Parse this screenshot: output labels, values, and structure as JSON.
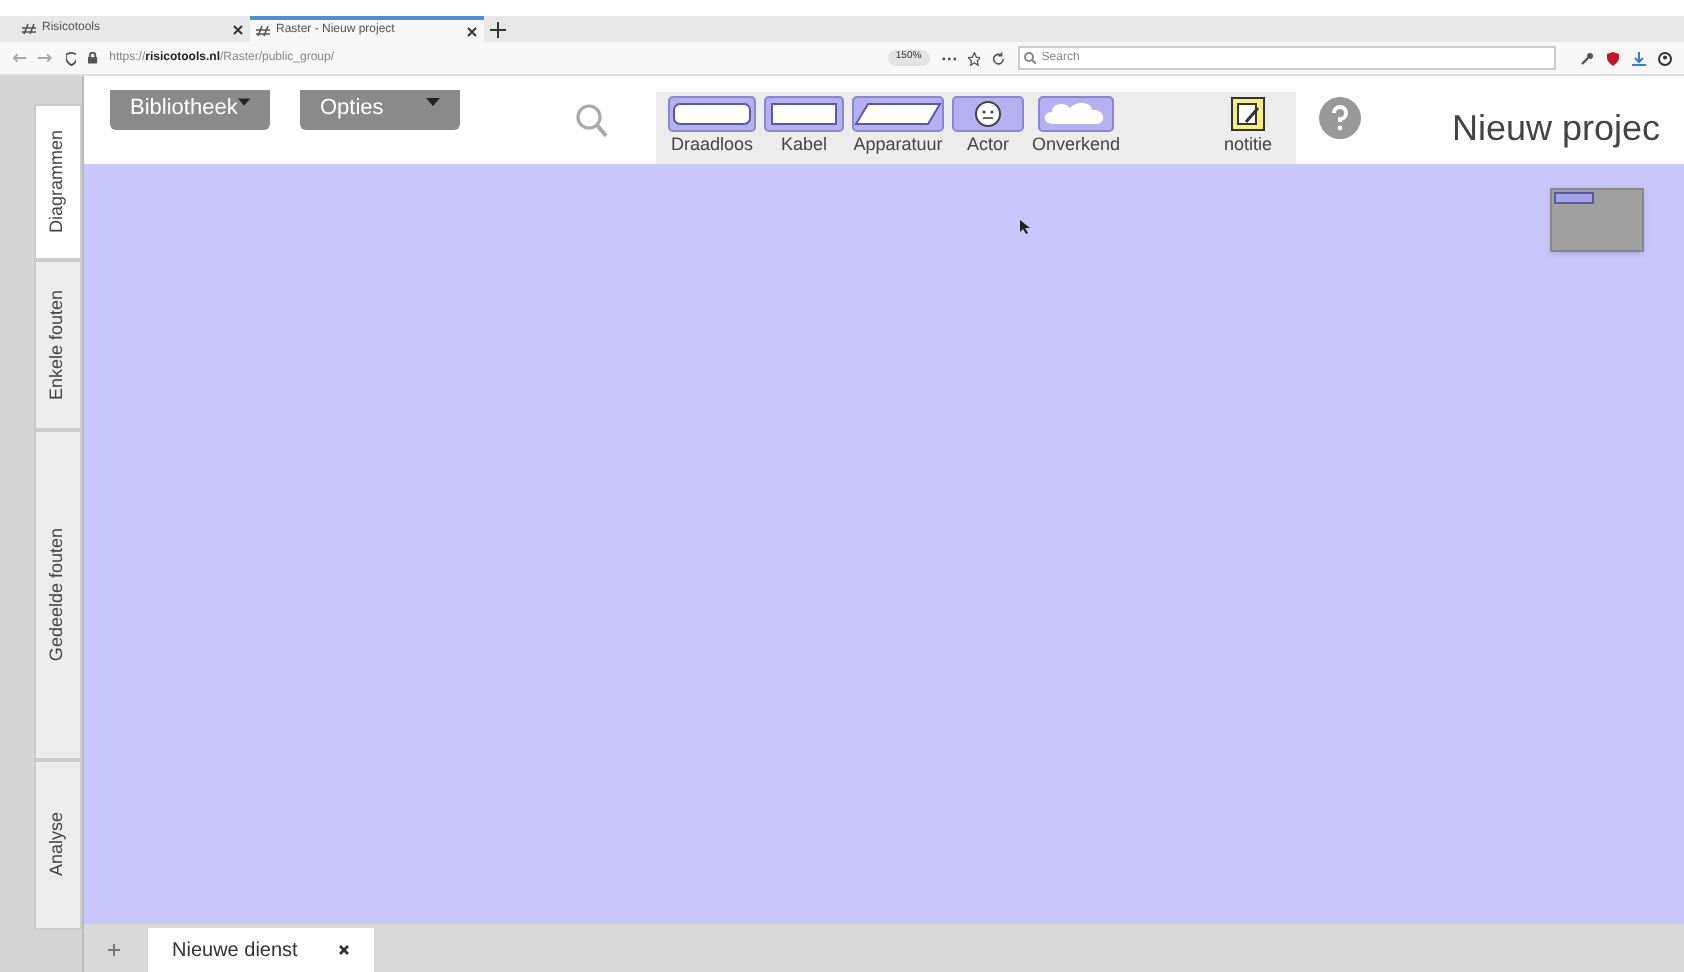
{
  "browser": {
    "tabs": [
      {
        "title": "Risicotools",
        "selected": false
      },
      {
        "title": "Raster - Nieuw project",
        "selected": true
      }
    ],
    "url_host": "risicotools.nl",
    "url_prefix": "https://",
    "url_path": "/Raster/public_group/",
    "zoom": "150%",
    "search_placeholder": "Search"
  },
  "toolbar": {
    "menus": [
      "Bibliotheek",
      "Opties"
    ],
    "shapes": [
      {
        "label": "Draadloos",
        "kind": "rounded"
      },
      {
        "label": "Kabel",
        "kind": "rect"
      },
      {
        "label": "Apparatuur",
        "kind": "parallelogram"
      },
      {
        "label": "Actor",
        "kind": "smiley"
      },
      {
        "label": "Onverkend",
        "kind": "cloud"
      }
    ],
    "note": "notitie",
    "project_title": "Nieuw projec"
  },
  "side_tabs": [
    {
      "label": "Diagrammen",
      "selected": true
    },
    {
      "label": "Enkele fouten",
      "selected": false
    },
    {
      "label": "Gedeelde fouten",
      "selected": false
    },
    {
      "label": "Analyse",
      "selected": false
    }
  ],
  "bottom_tabs": [
    {
      "label": "Nieuwe dienst",
      "selected": true
    }
  ]
}
